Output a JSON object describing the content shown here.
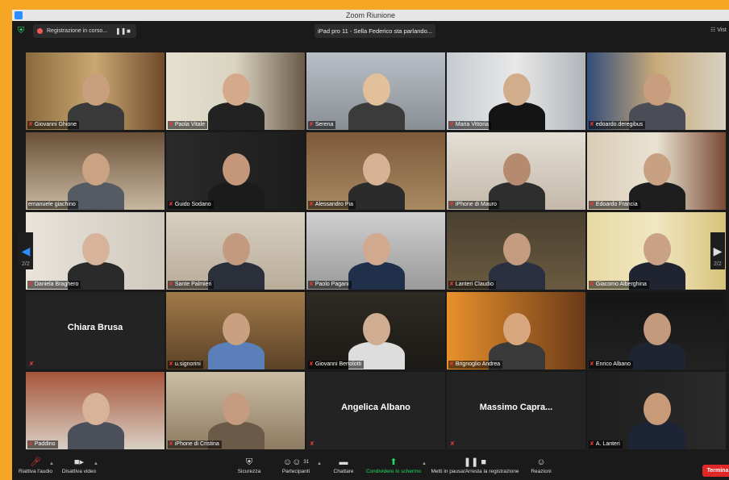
{
  "window": {
    "title": "Zoom Riunione"
  },
  "topbar": {
    "recording_text": "Registrazione in corso...",
    "pause_symbol": "❚❚",
    "stop_symbol": "■",
    "speaking_text": "iPad pro 11 - Sella Federico sta parlando...",
    "view_label": "Vist"
  },
  "participants": [
    {
      "name": "Giovanni Ghione",
      "muted": true
    },
    {
      "name": "Paola Vitale",
      "muted": true
    },
    {
      "name": "Serena",
      "muted": true
    },
    {
      "name": "Maria Vittoria",
      "muted": true
    },
    {
      "name": "edoardo.deregibus",
      "muted": true
    },
    {
      "name": "emanuele giachino",
      "muted": false
    },
    {
      "name": "Guido Sodano",
      "muted": true
    },
    {
      "name": "Alessandro Pia",
      "muted": true
    },
    {
      "name": "iPhone di Mauro",
      "muted": true
    },
    {
      "name": "Edoardo Francia",
      "muted": true
    },
    {
      "name": "Daniela Braghero",
      "muted": true
    },
    {
      "name": "Sante Palmieri",
      "muted": true
    },
    {
      "name": "Paolo Pagani",
      "muted": true
    },
    {
      "name": "Lanteri Claudio",
      "muted": true
    },
    {
      "name": "Giacomo Alberghina",
      "muted": true
    },
    {
      "name": "Chiara Brusa",
      "muted": true
    },
    {
      "name": "u.signorini",
      "muted": true
    },
    {
      "name": "Giovanni Bertolotti",
      "muted": true
    },
    {
      "name": "Brignoglio Andrea",
      "muted": true
    },
    {
      "name": "Enrico Albano",
      "muted": true
    },
    {
      "name": "Paddino",
      "muted": true
    },
    {
      "name": "iPhone di Cristina",
      "muted": true
    },
    {
      "name": "Angelica Albano",
      "muted": true
    },
    {
      "name": "Massimo Capra...",
      "muted": true
    },
    {
      "name": "A. Lanteri",
      "muted": true
    }
  ],
  "pager": {
    "left": "2/2",
    "right": "2/2"
  },
  "toolbar": {
    "unmute": "Riattiva l'audio",
    "stop_video": "Disattiva video",
    "security": "Sicurezza",
    "participants": "Partecipanti",
    "participants_count": "31",
    "chat": "Chattare",
    "share": "Condividere lo schermo",
    "record": "Metti in pausa/Arresta la registrazione",
    "reactions": "Reazioni",
    "end": "Termina"
  },
  "colors": {
    "accent": "#2d8cff",
    "share_green": "#23d962",
    "end_red": "#e02828",
    "frame_orange": "#f5a623"
  }
}
